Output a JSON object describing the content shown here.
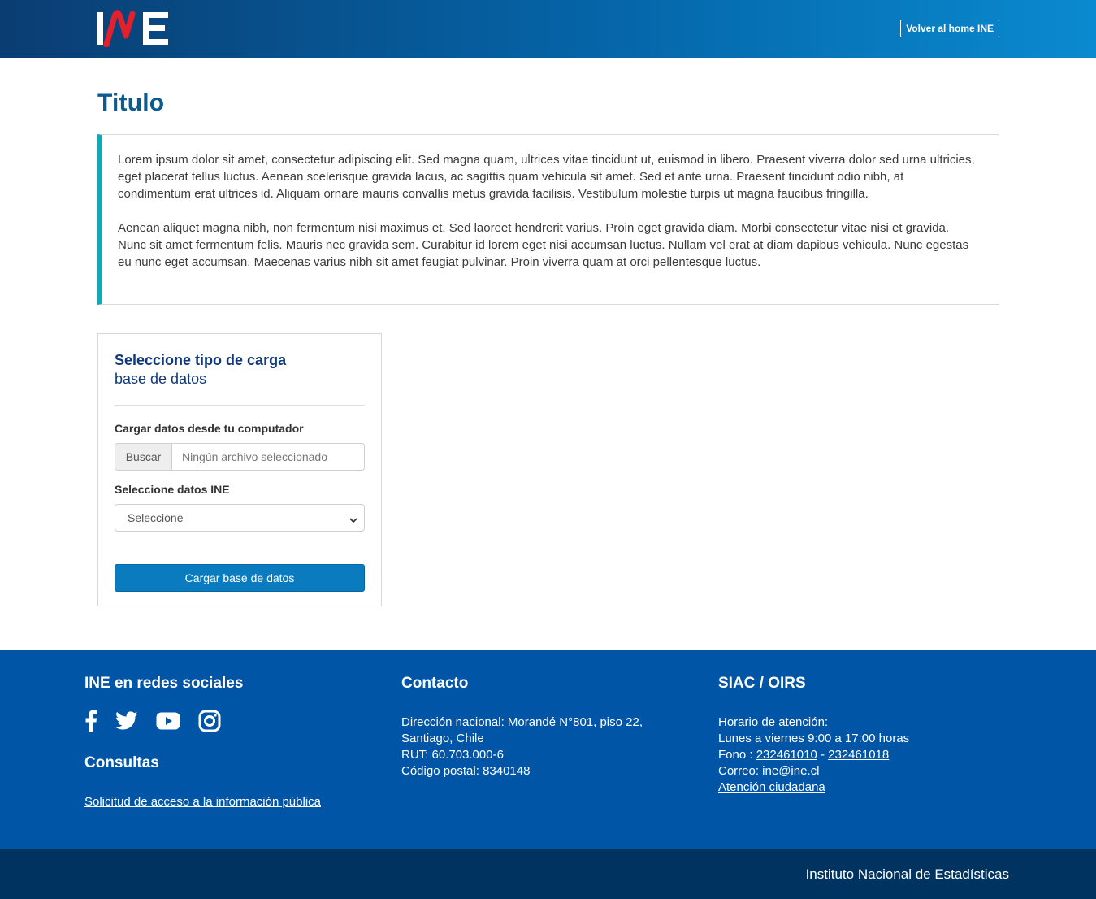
{
  "header": {
    "logo_text": "INE",
    "home_link": "Volver al home INE"
  },
  "main": {
    "title": "Titulo",
    "intro_paragraphs": [
      "Lorem ipsum dolor sit amet, consectetur adipiscing elit. Sed magna quam, ultrices vitae tincidunt ut, euismod in libero. Praesent viverra dolor sed urna ultricies, eget placerat tellus luctus. Aenean scelerisque gravida lacus, ac sagittis quam vehicula sit amet. Sed et ante urna. Praesent tincidunt odio nibh, at condimentum erat ultrices id. Aliquam ornare mauris convallis metus gravida facilisis. Vestibulum molestie turpis ut magna faucibus fringilla.",
      "Aenean aliquet magna nibh, non fermentum nisi maximus et. Sed laoreet hendrerit varius. Proin eget gravida diam. Morbi consectetur vitae nisi et gravida. Nunc sit amet fermentum felis. Mauris nec gravida sem. Curabitur id lorem eget nisi accumsan luctus. Nullam vel erat at diam dapibus vehicula. Nunc egestas eu nunc eget accumsan. Maecenas varius nibh sit amet feugiat pulvinar. Proin viverra quam at orci pellentesque luctus."
    ]
  },
  "upload_card": {
    "title": "Seleccione tipo de carga",
    "subtitle": "base de datos",
    "file_label": "Cargar datos desde tu computador",
    "file_button": "Buscar",
    "file_placeholder": "Ningún archivo seleccionado",
    "select_label": "Seleccione datos INE",
    "select_value": "Seleccione",
    "submit_label": "Cargar base de datos"
  },
  "footer": {
    "social_title": "INE en redes sociales",
    "social_icons": [
      "facebook-icon",
      "twitter-icon",
      "youtube-icon",
      "instagram-icon"
    ],
    "consultas_title": "Consultas",
    "consultas_link": "Solicitud de acceso a la información pública",
    "contact_title": "Contacto",
    "contact_lines": [
      "Dirección nacional: Morandé N°801, piso 22,",
      "Santiago, Chile",
      "RUT: 60.703.000-6",
      "Código postal: 8340148"
    ],
    "siac_title": "SIAC / OIRS",
    "siac_hours_label": "Horario de atención:",
    "siac_hours": "Lunes a viernes 9:00 a 17:00 horas",
    "siac_phone_label": "Fono : ",
    "siac_phone_1": "232461010",
    "siac_phone_sep": " - ",
    "siac_phone_2": "232461018",
    "siac_email": "Correo: ine@ine.cl",
    "siac_attention": "Atención ciudadana",
    "bottom_text": "Instituto Nacional de Estadísticas"
  },
  "colors": {
    "header_gradient_start": "#0a3d72",
    "header_gradient_end": "#0a8ad0",
    "title": "#0b5a90",
    "accent_border": "#13a8b8",
    "button": "#0a7bbf",
    "footer": "#0055a6",
    "footer_bottom": "#00335f",
    "logo_red": "#e3202b"
  }
}
